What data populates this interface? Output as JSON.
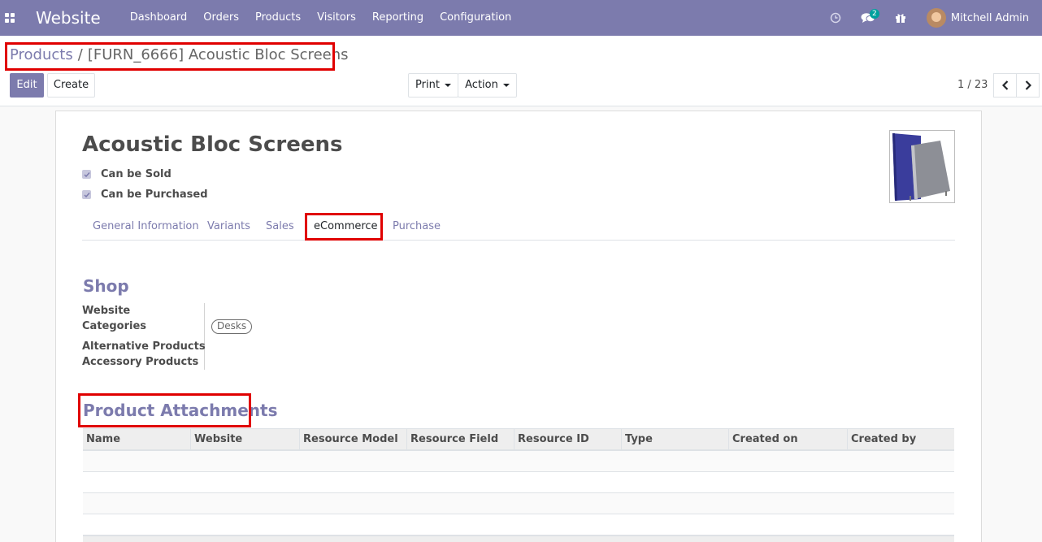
{
  "navbar": {
    "app_name": "Website",
    "menu": [
      "Dashboard",
      "Orders",
      "Products",
      "Visitors",
      "Reporting",
      "Configuration"
    ],
    "message_count": "2",
    "user_name": "Mitchell Admin",
    "accent_color": "#7c7bad"
  },
  "breadcrumb": {
    "parent": "Products",
    "separator": "/",
    "current": "[FURN_6666] Acoustic Bloc Screens"
  },
  "toolbar": {
    "edit_label": "Edit",
    "create_label": "Create",
    "print_label": "Print",
    "action_label": "Action"
  },
  "pager": {
    "value": "1 / 23"
  },
  "product": {
    "name": "Acoustic Bloc Screens",
    "can_be_sold_label": "Can be Sold",
    "can_be_purchased_label": "Can be Purchased",
    "can_be_sold": true,
    "can_be_purchased": true
  },
  "tabs": [
    "General Information",
    "Variants",
    "Sales",
    "eCommerce",
    "Purchase"
  ],
  "active_tab": "eCommerce",
  "shop": {
    "title": "Shop",
    "website_label": "Website",
    "categories_label": "Categories",
    "categories_tag": "Desks",
    "alternative_label": "Alternative Products",
    "accessory_label": "Accessory Products"
  },
  "attachments": {
    "title": "Product Attachments",
    "columns": [
      "Name",
      "Website",
      "Resource Model",
      "Resource Field",
      "Resource ID",
      "Type",
      "Created on",
      "Created by"
    ]
  },
  "icons": {
    "apps": "apps-grid-icon",
    "clock": "clock-icon",
    "chat": "chat-icon",
    "gift": "gift-icon",
    "prev": "chevron-left-icon",
    "next": "chevron-right-icon"
  },
  "highlight_color": "#e00000"
}
